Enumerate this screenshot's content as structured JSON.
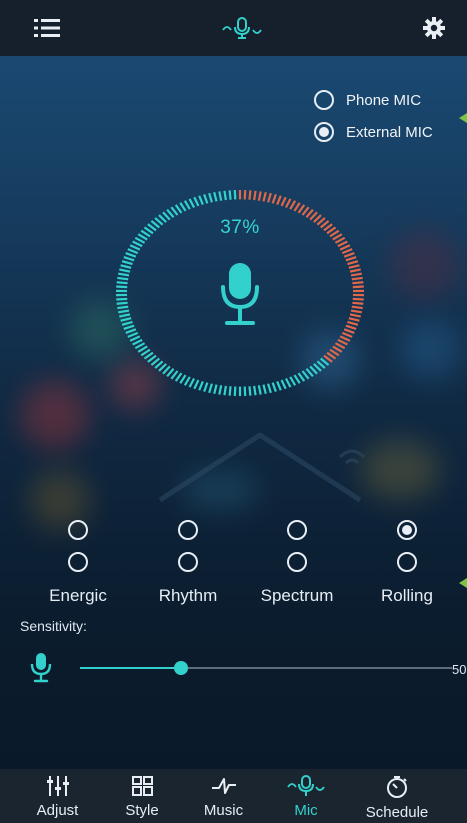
{
  "colors": {
    "accent": "#33d1cb",
    "meter_active": "#e0684a",
    "meter_inactive": "#33d1cb",
    "header_bg": "#15202c",
    "nav_bg": "#1b2530",
    "arrow": "#7ec24a"
  },
  "header": {
    "menu_icon": "hamburger-menu-icon",
    "center_icon": "mic-wave-icon",
    "settings_icon": "gear-icon"
  },
  "mic_source": {
    "options": [
      {
        "label": "Phone MIC",
        "selected": false
      },
      {
        "label": "External MIC",
        "selected": true
      }
    ]
  },
  "meter": {
    "level_text": "37%",
    "level": 0.37,
    "icon": "microphone-icon"
  },
  "styles": {
    "items": [
      {
        "label": "Energic",
        "row1": false,
        "row2": false
      },
      {
        "label": "Rhythm",
        "row1": false,
        "row2": false
      },
      {
        "label": "Spectrum",
        "row1": false,
        "row2": false
      },
      {
        "label": "Rolling",
        "row1": true,
        "row2": false
      }
    ]
  },
  "sensitivity": {
    "label": "Sensitivity:",
    "value": 50,
    "value_text": "50",
    "min": 0,
    "max": 100,
    "icon": "microphone-icon"
  },
  "nav": {
    "items": [
      {
        "label": "Adjust",
        "icon": "sliders-icon",
        "active": false
      },
      {
        "label": "Style",
        "icon": "grid-icon",
        "active": false
      },
      {
        "label": "Music",
        "icon": "music-note-icon",
        "active": false
      },
      {
        "label": "Mic",
        "icon": "mic-wave-icon",
        "active": true
      },
      {
        "label": "Schedule",
        "icon": "timer-icon",
        "active": false
      }
    ]
  }
}
